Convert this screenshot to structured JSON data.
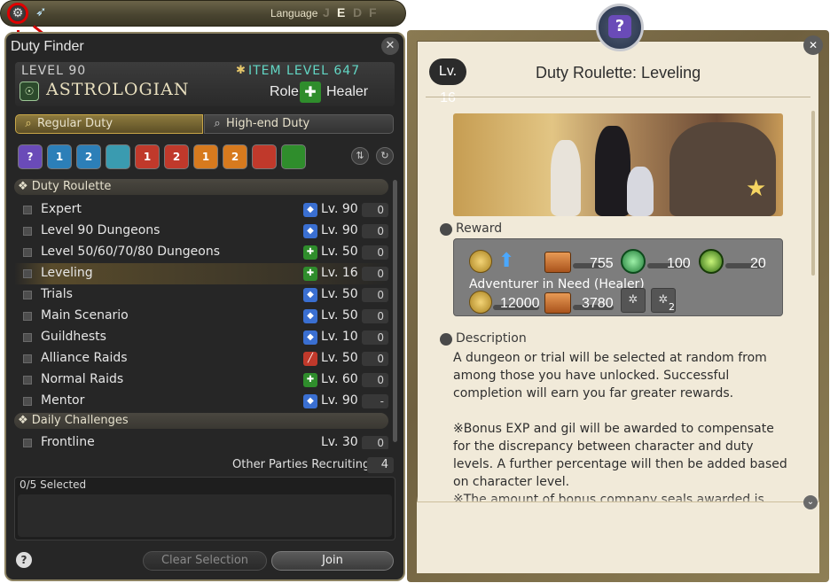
{
  "topbar": {
    "language_label": "Language",
    "languages": [
      "J",
      "E",
      "D",
      "F"
    ],
    "active_language": "E"
  },
  "duty_finder": {
    "title": "Duty Finder",
    "level": "LEVEL 90",
    "job": "ASTROLOGIAN",
    "item_level": "ITEM LEVEL 647",
    "role_label": "Role:",
    "role": "Healer",
    "tabs": [
      {
        "label": "Regular Duty",
        "active": true
      },
      {
        "label": "High-end Duty",
        "active": false
      }
    ],
    "category_badges": [
      "",
      "1",
      "2",
      "",
      "1",
      "2",
      "1",
      "2",
      "",
      ""
    ],
    "sections": [
      {
        "label": "Duty Roulette",
        "rows": [
          {
            "name": "Expert",
            "level": "Lv. 90",
            "count": "0",
            "icon_color": "#3a6fd1"
          },
          {
            "name": "Level 90 Dungeons",
            "level": "Lv. 90",
            "count": "0",
            "icon_color": "#3a6fd1"
          },
          {
            "name": "Level 50/60/70/80 Dungeons",
            "level": "Lv. 50",
            "count": "0",
            "icon_color": "#2f8d2c"
          },
          {
            "name": "Leveling",
            "level": "Lv. 16",
            "count": "0",
            "icon_color": "#2f8d2c",
            "selected": true
          },
          {
            "name": "Trials",
            "level": "Lv. 50",
            "count": "0",
            "icon_color": "#3a6fd1"
          },
          {
            "name": "Main Scenario",
            "level": "Lv. 50",
            "count": "0",
            "icon_color": "#3a6fd1"
          },
          {
            "name": "Guildhests",
            "level": "Lv. 10",
            "count": "0",
            "icon_color": "#3a6fd1"
          },
          {
            "name": "Alliance Raids",
            "level": "Lv. 50",
            "count": "0",
            "icon_color": "#c0392b"
          },
          {
            "name": "Normal Raids",
            "level": "Lv. 60",
            "count": "0",
            "icon_color": "#2f8d2c"
          },
          {
            "name": "Mentor",
            "level": "Lv. 90",
            "count": "-",
            "icon_color": "#3a6fd1"
          }
        ]
      },
      {
        "label": "Daily Challenges",
        "rows": [
          {
            "name": "Frontline",
            "level": "Lv. 30",
            "count": "0",
            "icon_color": "#262626"
          }
        ]
      }
    ],
    "recruiting_label": "Other Parties Recruiting",
    "recruiting_count": "4",
    "selected_label": "0/5 Selected",
    "help_label": "?",
    "clear_label": "Clear Selection",
    "join_label": "Join"
  },
  "detail": {
    "level_badge": "Lv. 16",
    "title": "Duty Roulette: Leveling",
    "reward_label": "Reward",
    "rewards_row1": [
      "755",
      "100",
      "20"
    ],
    "adventurer_label": "Adventurer in Need (Healer)",
    "rewards_row2": [
      "12000",
      "3780"
    ],
    "bonus_badge": "2",
    "description_label": "Description",
    "paragraphs": [
      "A dungeon or trial will be selected at random from among those you have unlocked. Successful completion will earn you far greater rewards.",
      "※Bonus EXP and gil will be awarded to compensate for the discrepancy between character and duty levels. A further percentage will then be added based on character level.",
      "※The amount of bonus company seals awarded is"
    ]
  }
}
